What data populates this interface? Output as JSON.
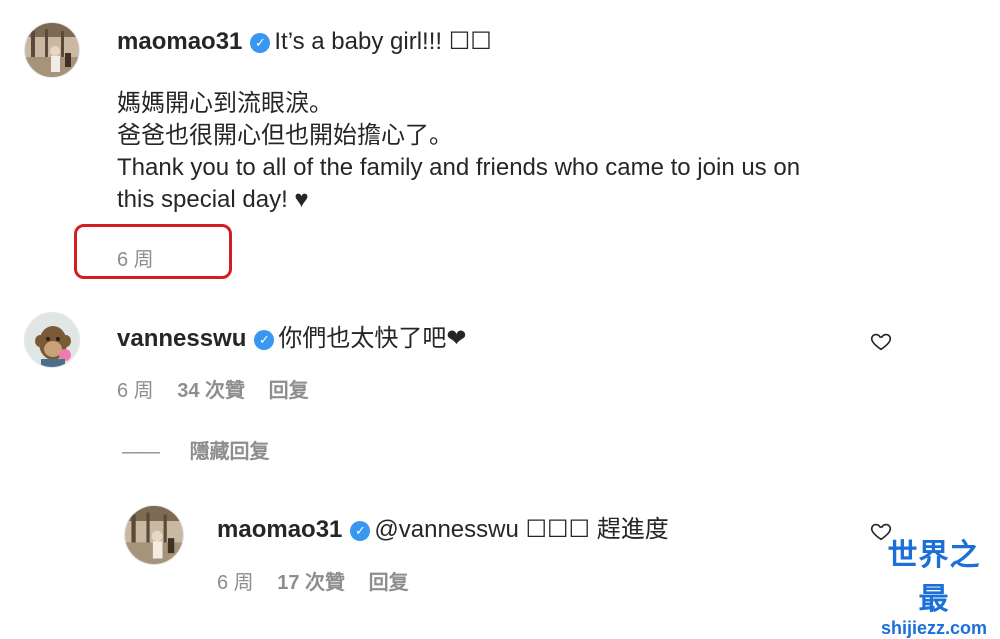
{
  "post": {
    "username": "maomao31",
    "verified_icon": "verified-badge-icon",
    "caption_first": "It’s a baby girl!!! ☐☐",
    "body_lines": [
      "媽媽開心到流眼淚。",
      "爸爸也很開心但也開始擔心了。",
      "Thank you to all of the family and friends who came to join us on",
      "this special day! ♥"
    ],
    "time": "6 周"
  },
  "comment": {
    "username": "vannesswu",
    "text": "你們也太快了吧❤",
    "time": "6 周",
    "likes": "34 次贊",
    "reply_label": "回复",
    "hide_replies_line": "——",
    "hide_replies_label": "隱藏回复"
  },
  "reply": {
    "username": "maomao31",
    "text": "@vannesswu ☐☐☐ 趕進度",
    "time": "6 周",
    "likes": "17 次贊",
    "reply_label": "回复"
  },
  "watermark": {
    "title": "世界之最",
    "url": "shijiezz.com"
  },
  "colors": {
    "highlight": "#d21e1e",
    "verified": "#3897f0",
    "watermark": "#1a6fd8"
  }
}
